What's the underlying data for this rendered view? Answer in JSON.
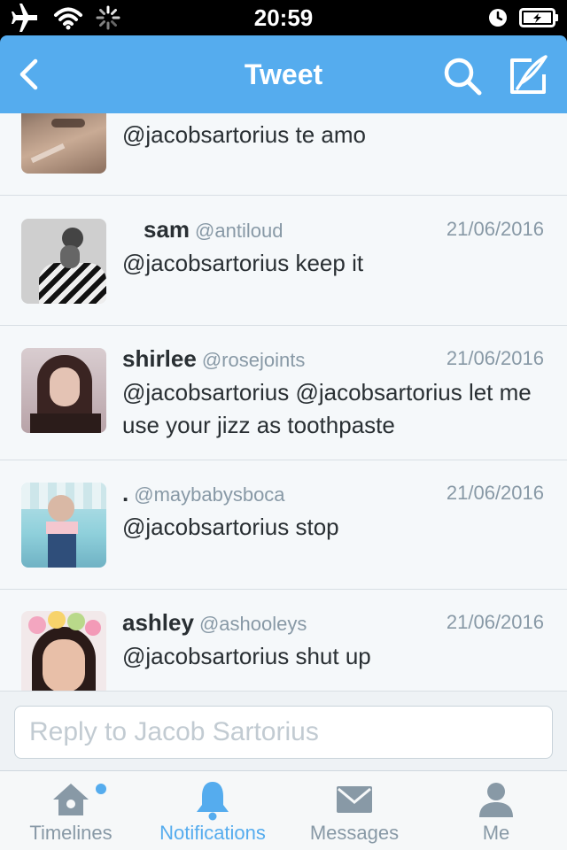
{
  "status_bar": {
    "time": "20:59"
  },
  "nav": {
    "title": "Tweet",
    "back_icon": "chevron-left-icon",
    "search_icon": "search-icon",
    "compose_icon": "compose-icon"
  },
  "tweets": [
    {
      "name": "",
      "handle": "",
      "date": "",
      "text": "@jacobsartorius te amo"
    },
    {
      "name": "sam",
      "handle": "@antiloud",
      "date": "21/06/2016",
      "text": "@jacobsartorius keep it"
    },
    {
      "name": "shirlee",
      "handle": "@rosejoints",
      "date": "21/06/2016",
      "text": "@jacobsartorius @jacobsartorius let me use your jizz as toothpaste"
    },
    {
      "name": ".",
      "handle": "@maybabysboca",
      "date": "21/06/2016",
      "text": "@jacobsartorius stop"
    },
    {
      "name": "ashley",
      "handle": "@ashooleys",
      "date": "21/06/2016",
      "text": "@jacobsartorius shut up"
    }
  ],
  "reply": {
    "placeholder": "Reply to Jacob Sartorius",
    "value": ""
  },
  "tabs": [
    {
      "label": "Timelines",
      "icon": "home-icon",
      "active": false,
      "has_dot": true
    },
    {
      "label": "Notifications",
      "icon": "bell-icon",
      "active": true,
      "has_dot": false
    },
    {
      "label": "Messages",
      "icon": "envelope-icon",
      "active": false,
      "has_dot": false
    },
    {
      "label": "Me",
      "icon": "person-icon",
      "active": false,
      "has_dot": false
    }
  ],
  "colors": {
    "accent": "#55acee",
    "text_primary": "#292f33",
    "text_secondary": "#8899a6",
    "feed_background": "#f5f8fa",
    "tab_inactive": "#8899a6"
  }
}
